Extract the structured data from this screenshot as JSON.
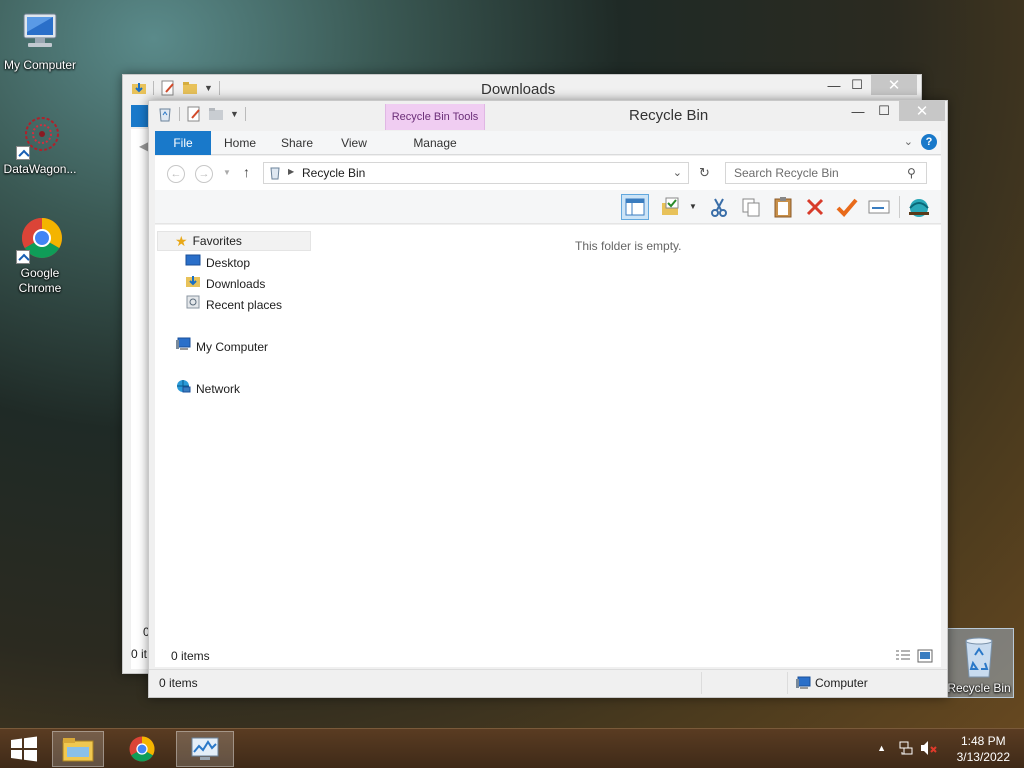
{
  "desktop": {
    "icons": [
      {
        "label": "My Computer"
      },
      {
        "label": "DataWagon..."
      },
      {
        "label": "Google Chrome"
      },
      {
        "label": "Recycle Bin"
      }
    ]
  },
  "back_window": {
    "title": "Downloads",
    "status_items": "0 it",
    "partial_value": "0"
  },
  "front_window": {
    "title": "Recycle Bin",
    "context_tab_header": "Recycle Bin Tools",
    "tabs": [
      "File",
      "Home",
      "Share",
      "View",
      "Manage"
    ],
    "address": "Recycle Bin",
    "search_placeholder": "Search Recycle Bin",
    "empty_message": "This folder is empty.",
    "nav": {
      "favorites": "Favorites",
      "desktop": "Desktop",
      "downloads": "Downloads",
      "recent": "Recent places",
      "computer": "My Computer",
      "network": "Network"
    },
    "status_items": "0 items",
    "outer_status_items": "0 items",
    "outer_status_location": "Computer"
  },
  "taskbar": {
    "time": "1:48 PM",
    "date": "3/13/2022"
  },
  "colors": {
    "accent": "#1979ca",
    "context_tab": "#f0cdf2"
  }
}
